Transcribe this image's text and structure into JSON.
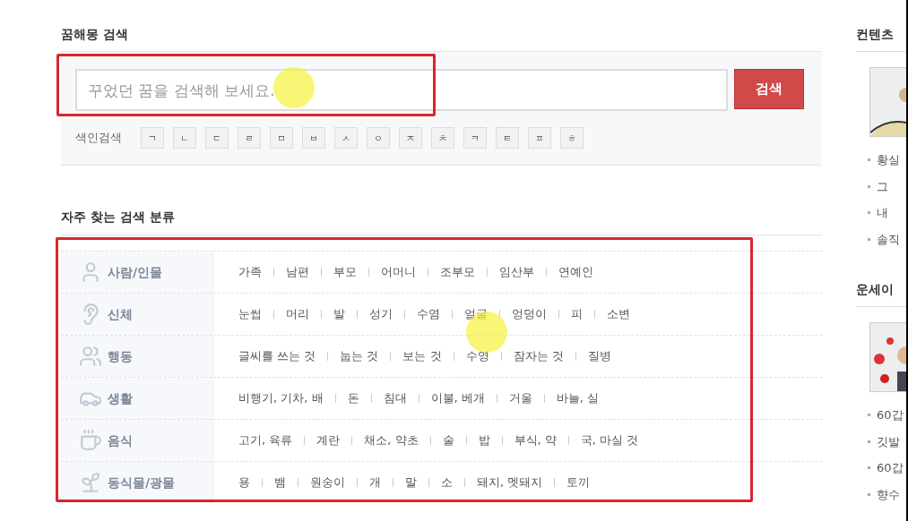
{
  "search_section": {
    "title": "꿈해몽 검색",
    "placeholder": "꾸었던 꿈을 검색해 보세요.",
    "button": "검색",
    "index_label": "색인검색",
    "index_keys": [
      "ㄱ",
      "ㄴ",
      "ㄷ",
      "ㄹ",
      "ㅁ",
      "ㅂ",
      "ㅅ",
      "ㅇ",
      "ㅈ",
      "ㅊ",
      "ㅋ",
      "ㅌ",
      "ㅍ",
      "ㅎ"
    ]
  },
  "category_section": {
    "title": "자주 찾는 검색 분류",
    "rows": [
      {
        "kind": "person",
        "label": "사람/인물",
        "items": [
          "가족",
          "남편",
          "부모",
          "어머니",
          "조부모",
          "임산부",
          "연예인"
        ]
      },
      {
        "kind": "body",
        "label": "신체",
        "items": [
          "눈썹",
          "머리",
          "발",
          "성기",
          "수염",
          "얼굴",
          "엉덩이",
          "피",
          "소변"
        ]
      },
      {
        "kind": "action",
        "label": "행동",
        "items": [
          "글씨를 쓰는 것",
          "눕는 것",
          "보는 것",
          "수영",
          "잠자는 것",
          "질병"
        ]
      },
      {
        "kind": "life",
        "label": "생활",
        "items": [
          "비행기, 기차, 배",
          "돈",
          "침대",
          "이불, 베개",
          "거울",
          "바늘, 실"
        ]
      },
      {
        "kind": "food",
        "label": "음식",
        "items": [
          "고기, 육류",
          "계란",
          "채소, 약초",
          "술",
          "밥",
          "부식, 약",
          "국, 마실 것"
        ]
      },
      {
        "kind": "plant",
        "label": "동식물/광물",
        "items": [
          "용",
          "뱀",
          "원숭이",
          "개",
          "말",
          "소",
          "돼지, 멧돼지",
          "토끼"
        ]
      }
    ]
  },
  "sidebar": {
    "sections": [
      {
        "title": "컨텐츠",
        "items": [
          "황실",
          "그",
          "내",
          "솔직"
        ]
      },
      {
        "title": "운세이",
        "items": [
          "60갑",
          "깃발",
          "60갑",
          "향수"
        ]
      }
    ]
  }
}
